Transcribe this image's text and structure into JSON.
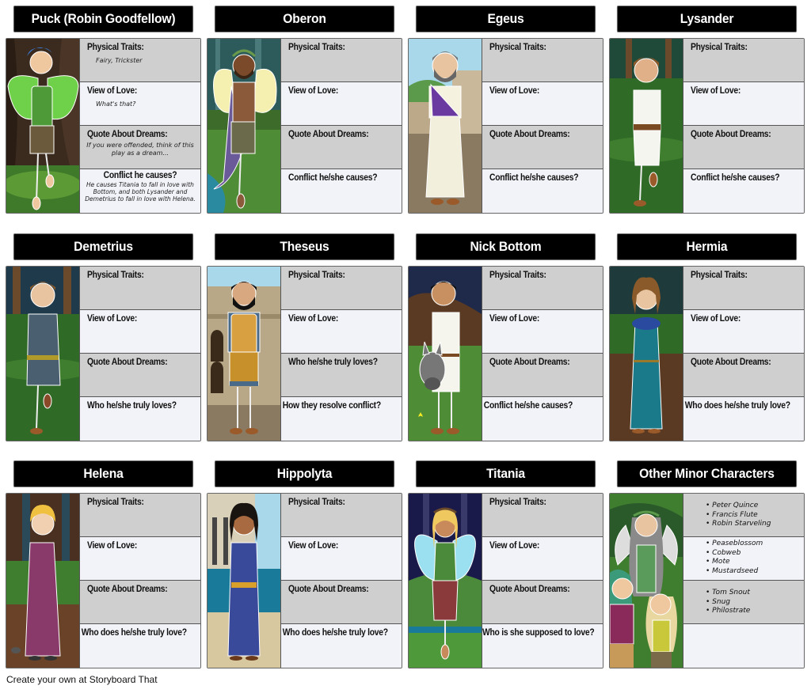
{
  "footer": "Create your own at Storyboard That",
  "colors": {
    "title_bg": "#000000",
    "gray_box": "#cfcfcf",
    "light_box": "#f2f3f8"
  },
  "cards": [
    {
      "title": "Puck (Robin Goodfellow)",
      "art": "fairy-boy-forest",
      "boxes": [
        {
          "label": "Physical Traits:",
          "answer": "Fairy, Trickster"
        },
        {
          "label": "View of Love:",
          "answer": "What's that?"
        },
        {
          "label": "Quote About Dreams:",
          "answer": "If you were offended, think of this play as a dream..."
        },
        {
          "label": "Conflict he causes?",
          "answer": "He causes Titania to fall in love with Bottom, and both Lysander and Demetrius to fall in love with Helena."
        }
      ]
    },
    {
      "title": "Oberon",
      "art": "fairy-king-river",
      "boxes": [
        {
          "label": "Physical Traits:",
          "answer": ""
        },
        {
          "label": "View of Love:",
          "answer": ""
        },
        {
          "label": "Quote About Dreams:",
          "answer": ""
        },
        {
          "label": "Conflict he/she causes?",
          "answer": ""
        }
      ]
    },
    {
      "title": "Egeus",
      "art": "old-man-athens",
      "boxes": [
        {
          "label": "Physical Traits:",
          "answer": ""
        },
        {
          "label": "View of Love:",
          "answer": ""
        },
        {
          "label": "Quote About Dreams:",
          "answer": ""
        },
        {
          "label": "Conflict he/she causes?",
          "answer": ""
        }
      ]
    },
    {
      "title": "Lysander",
      "art": "young-man-forest",
      "boxes": [
        {
          "label": "Physical Traits:",
          "answer": ""
        },
        {
          "label": "View of Love:",
          "answer": ""
        },
        {
          "label": "Quote About Dreams:",
          "answer": ""
        },
        {
          "label": "Conflict he/she causes?",
          "answer": ""
        }
      ]
    },
    {
      "title": "Demetrius",
      "art": "young-man-tunic-forest",
      "boxes": [
        {
          "label": "Physical Traits:",
          "answer": ""
        },
        {
          "label": "View of Love:",
          "answer": ""
        },
        {
          "label": "Quote About Dreams:",
          "answer": ""
        },
        {
          "label": "Who he/she truly loves?",
          "answer": ""
        }
      ]
    },
    {
      "title": "Theseus",
      "art": "armored-duke-colosseum",
      "boxes": [
        {
          "label": "Physical Traits:",
          "answer": ""
        },
        {
          "label": "View of Love:",
          "answer": ""
        },
        {
          "label": "Who he/she truly loves?",
          "answer": ""
        },
        {
          "label": "How they resolve conflict?",
          "answer": ""
        }
      ]
    },
    {
      "title": "Nick Bottom",
      "art": "weaver-donkey-head",
      "boxes": [
        {
          "label": "Physical Traits:",
          "answer": ""
        },
        {
          "label": "View of Love:",
          "answer": ""
        },
        {
          "label": "Quote About Dreams:",
          "answer": ""
        },
        {
          "label": "Conflict he/she causes?",
          "answer": ""
        }
      ]
    },
    {
      "title": "Hermia",
      "art": "woman-teal-dress-forest",
      "boxes": [
        {
          "label": "Physical Traits:",
          "answer": ""
        },
        {
          "label": "View of Love:",
          "answer": ""
        },
        {
          "label": "Quote About Dreams:",
          "answer": ""
        },
        {
          "label": "Who does he/she truly love?",
          "answer": ""
        }
      ]
    },
    {
      "title": "Helena",
      "art": "woman-maroon-dress-forest",
      "boxes": [
        {
          "label": "Physical Traits:",
          "answer": ""
        },
        {
          "label": "View of Love:",
          "answer": ""
        },
        {
          "label": "Quote About Dreams:",
          "answer": ""
        },
        {
          "label": "Who does he/she truly love?",
          "answer": ""
        }
      ]
    },
    {
      "title": "Hippolyta",
      "art": "queen-blue-dress-sea",
      "boxes": [
        {
          "label": "Physical Traits:",
          "answer": ""
        },
        {
          "label": "View of Love:",
          "answer": ""
        },
        {
          "label": "Quote About Dreams:",
          "answer": ""
        },
        {
          "label": "Who does he/she truly love?",
          "answer": ""
        }
      ]
    },
    {
      "title": "Titania",
      "art": "fairy-queen-night",
      "boxes": [
        {
          "label": "Physical Traits:",
          "answer": ""
        },
        {
          "label": "View of Love:",
          "answer": ""
        },
        {
          "label": "Quote About Dreams:",
          "answer": ""
        },
        {
          "label": "Who is she supposed to love?",
          "answer": ""
        }
      ]
    },
    {
      "title": "Other Minor Characters",
      "art": "three-fairies",
      "groups": [
        [
          "Peter Quince",
          "Francis Flute",
          "Robin Starveling"
        ],
        [
          "Peaseblossom",
          "Cobweb",
          "Mote",
          "Mustardseed"
        ],
        [
          "Tom Snout",
          "Snug",
          "Philostrate"
        ],
        []
      ]
    }
  ]
}
